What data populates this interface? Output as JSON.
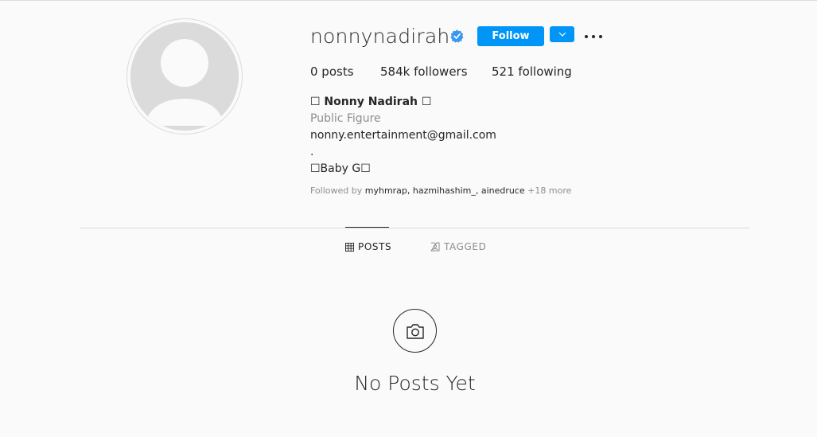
{
  "profile": {
    "username": "nonnynadirah",
    "verified": true,
    "follow_label": "Follow",
    "stats": {
      "posts": "0 posts",
      "followers": "584k followers",
      "following": "521 following"
    },
    "bio": {
      "name": "☐ Nonny Nadirah ☐",
      "category": "Public Figure",
      "lines": [
        "nonny.entertainment@gmail.com",
        ".",
        "☐Baby G☐"
      ]
    },
    "followed_by_prefix": "Followed by ",
    "followed_by_users": "myhmrap, hazmihashim_, ainedruce",
    "followed_by_more": " +18 more"
  },
  "tabs": [
    {
      "label": "POSTS",
      "active": true
    },
    {
      "label": "TAGGED",
      "active": false
    }
  ],
  "empty_state": {
    "title": "No Posts Yet"
  },
  "colors": {
    "accent": "#0095f6",
    "text": "#262626",
    "muted": "#8e8e8e",
    "border": "#dbdbdb",
    "background": "#fafafa"
  },
  "icons": [
    "verified-badge-icon",
    "chevron-down-icon",
    "more-options-icon",
    "grid-icon",
    "tagged-icon",
    "camera-icon",
    "default-avatar-icon"
  ]
}
